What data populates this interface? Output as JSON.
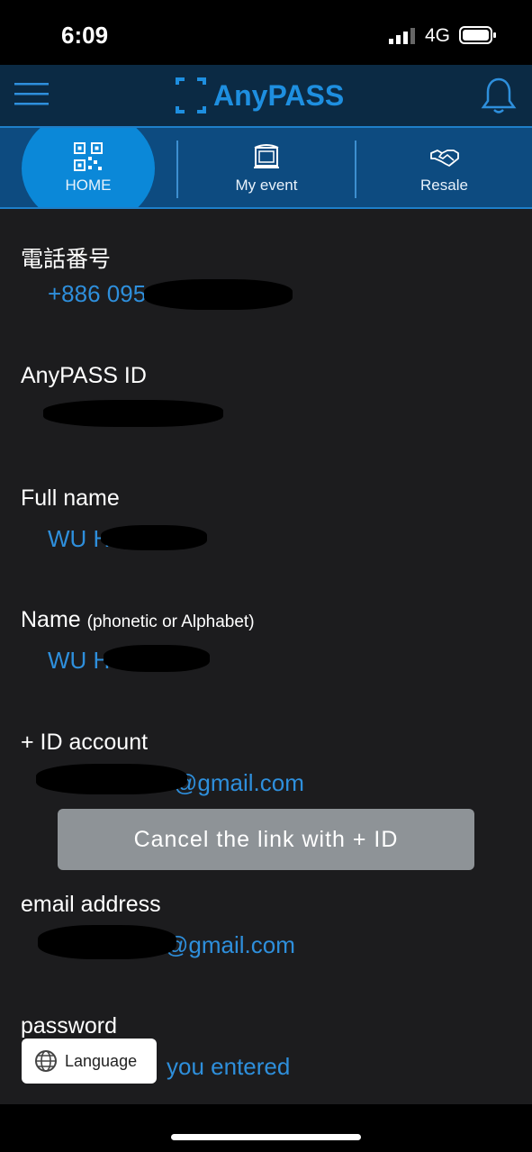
{
  "status": {
    "time": "6:09",
    "network": "4G"
  },
  "header": {
    "logo_text": "AnyPASS"
  },
  "tabs": [
    {
      "label": "HOME",
      "icon": "qr-code-icon",
      "active": true
    },
    {
      "label": "My event",
      "icon": "stage-icon",
      "active": false
    },
    {
      "label": "Resale",
      "icon": "handshake-icon",
      "active": false
    }
  ],
  "profile": {
    "phone": {
      "label": "電話番号",
      "value": "+886 095"
    },
    "anypass_id": {
      "label": "AnyPASS ID",
      "value": ""
    },
    "full_name": {
      "label": "Full name",
      "value": "WU H"
    },
    "phonetic_name": {
      "label": "Name",
      "label_note": "(phonetic or Alphabet)",
      "value": "WU H"
    },
    "plus_id": {
      "label": "+ ID account",
      "value": "@gmail.com",
      "cancel_label": "Cancel the link with + ID"
    },
    "email": {
      "label": "email address",
      "value": "@gmail.com"
    },
    "password": {
      "label": "password",
      "value": "you entered"
    }
  },
  "language_button": {
    "label": "Language"
  },
  "colors": {
    "accent": "#2e8fdc",
    "header_bg": "#0b2a44",
    "tab_bg": "#0d4b80",
    "active_tab": "#0b88d8",
    "page_bg": "#1c1c1e"
  }
}
